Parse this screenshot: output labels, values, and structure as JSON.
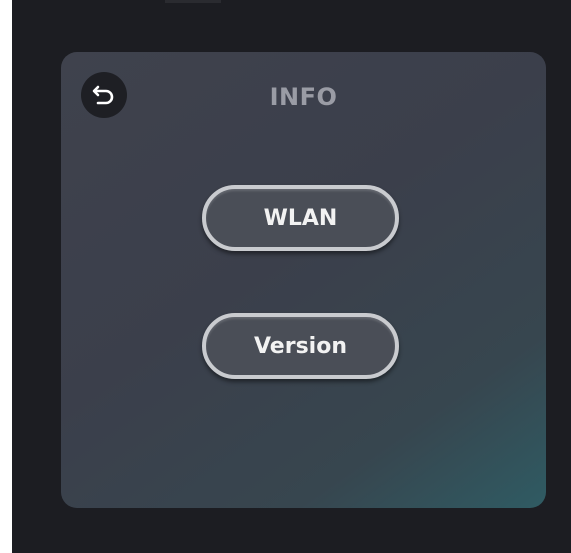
{
  "header": {
    "title": "INFO",
    "back_icon": "back-arrow-icon"
  },
  "menu": {
    "items": [
      {
        "label": "WLAN"
      },
      {
        "label": "Version"
      }
    ]
  },
  "colors": {
    "background": "#1c1d22",
    "panel_start": "#3f424d",
    "panel_end": "#2f5b63",
    "button_fill": "#4a4e57",
    "button_border": "#c9cbcf",
    "title_text": "#9a9ca5"
  }
}
